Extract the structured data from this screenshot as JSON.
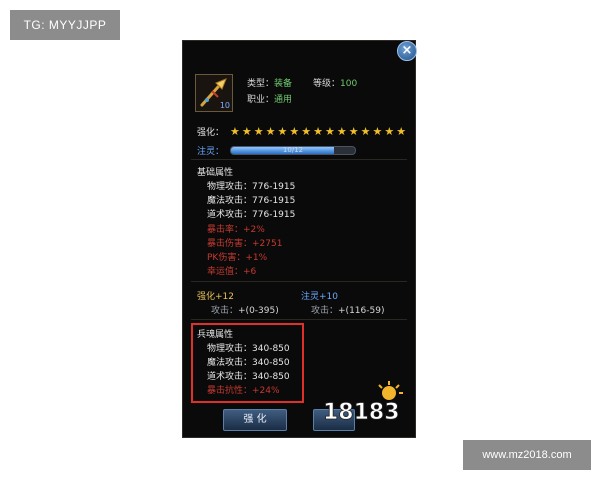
{
  "watermarks": {
    "top_left": "TG: MYYJJPP",
    "bottom_right": "www.mz2018.com"
  },
  "tooltip": {
    "item_name": "",
    "icon": "golden-spear-icon",
    "icon_level": "10",
    "type_label": "类型：",
    "type_value": "装备",
    "level_label": "等级：",
    "level_value": "100",
    "class_label": "职业：",
    "class_value": "通用",
    "enhance_label": "强化：",
    "stars_count": 15,
    "soul_label": "注灵：",
    "soul_progress_text": "10/12",
    "soul_progress": 0.833,
    "base_title": "基础属性",
    "base_attrs": [
      {
        "label": "物理攻击：",
        "value": "776-1915"
      },
      {
        "label": "魔法攻击：",
        "value": "776-1915"
      },
      {
        "label": "道术攻击：",
        "value": "776-1915"
      }
    ],
    "extra_attrs": [
      {
        "label": "暴击率：",
        "value": "+2%"
      },
      {
        "label": "暴击伤害：",
        "value": "+2751"
      },
      {
        "label": "PK伤害：",
        "value": "+1%"
      },
      {
        "label": "幸运值：",
        "value": "+6"
      }
    ],
    "enhance_plus": "强化+12",
    "enhance_attack_label": "攻击：",
    "enhance_attack_value": "+(0-395)",
    "soul_plus": "注灵+10",
    "soul_attack_label": "攻击：",
    "soul_attack_value": "+(116-59)",
    "soul_title": "兵魂属性",
    "soul_attrs": [
      {
        "label": "物理攻击：",
        "value": "340-850"
      },
      {
        "label": "魔法攻击：",
        "value": "340-850"
      },
      {
        "label": "道术攻击：",
        "value": "340-850"
      }
    ],
    "soul_extra": {
      "label": "暴击抗性：",
      "value": "+24%"
    },
    "enhance_button": "强 化",
    "logo_text": "18183",
    "colors": {
      "item_name": "#d4332c",
      "green": "#6fc96f",
      "blue": "#6aa8ff",
      "red": "#c53a30",
      "star": "#f0c02a",
      "highlight": "#e0302a"
    }
  }
}
